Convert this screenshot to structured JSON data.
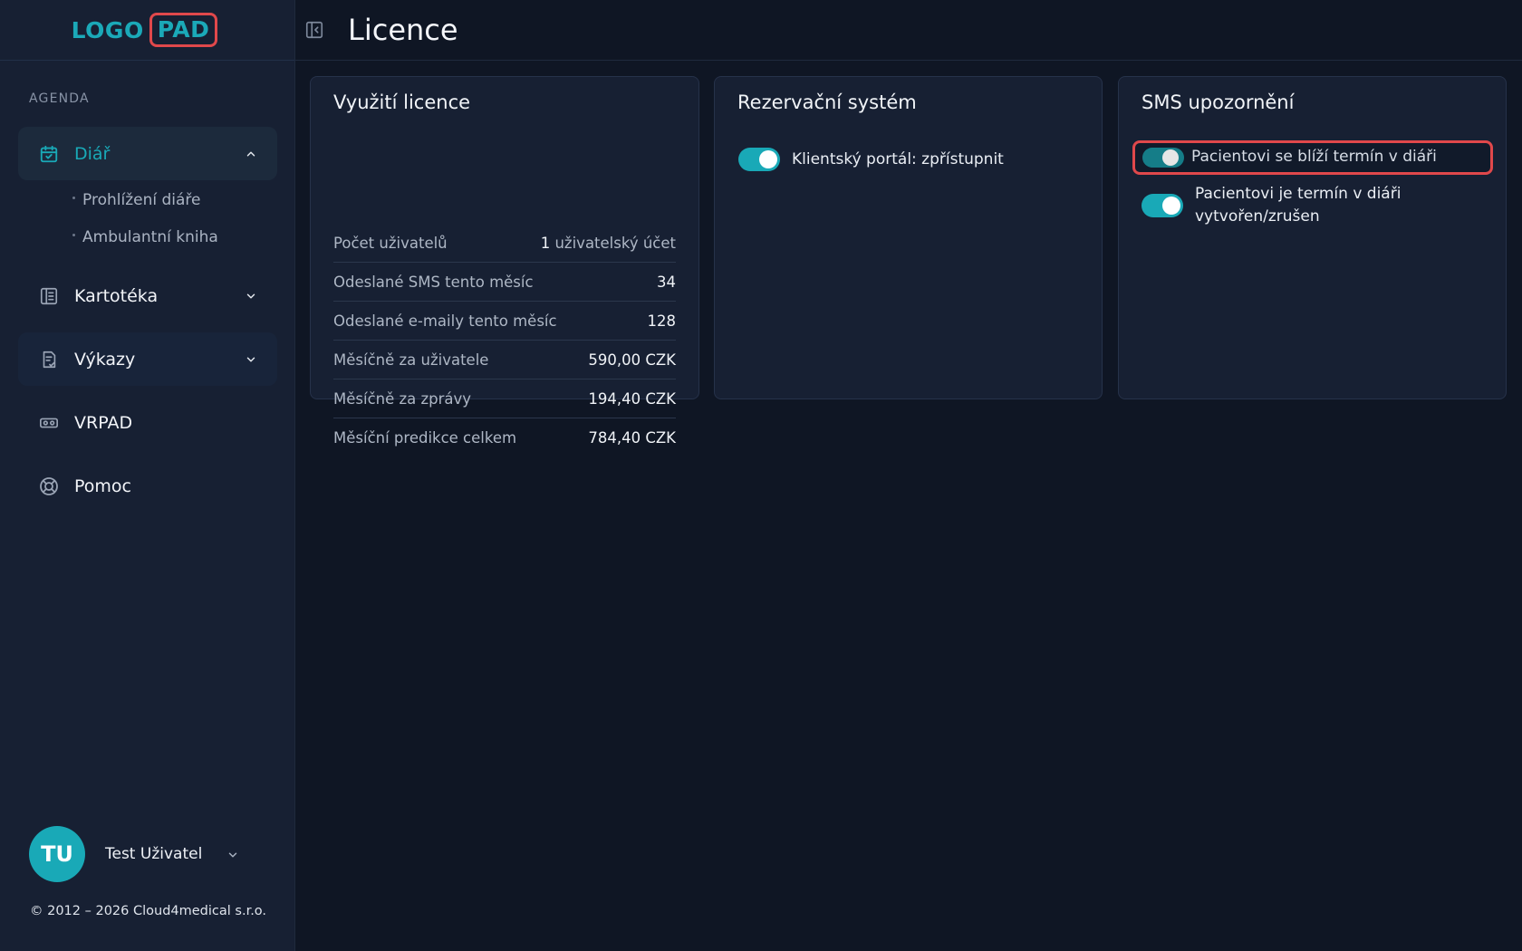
{
  "logo": {
    "part1": "LOGO",
    "part2": "PAD"
  },
  "sidebar": {
    "section_label": "AGENDA",
    "items": [
      {
        "label": "Diář",
        "icon": "calendar-check-icon",
        "expanded": true
      },
      {
        "label": "Kartotéka",
        "icon": "folder-book-icon",
        "expanded": false
      },
      {
        "label": "Výkazy",
        "icon": "report-icon",
        "expanded": false
      },
      {
        "label": "VRPAD",
        "icon": "vr-headset-icon"
      },
      {
        "label": "Pomoc",
        "icon": "lifebuoy-icon"
      }
    ],
    "diar_sub": [
      "Prohlížení diáře",
      "Ambulantní kniha"
    ]
  },
  "user": {
    "initials": "TU",
    "name": "Test Uživatel"
  },
  "copyright": "© 2012 – 2026 Cloud4medical s.r.o.",
  "header": {
    "title": "Licence"
  },
  "license_card": {
    "title": "Využití licence",
    "rows": [
      {
        "label": "Počet uživatelů",
        "value_num": "1",
        "value_text": " uživatelský účet"
      },
      {
        "label": "Odeslané SMS tento měsíc",
        "value": "34"
      },
      {
        "label": "Odeslané e-maily tento měsíc",
        "value": "128"
      },
      {
        "label": "Měsíčně za uživatele",
        "value": "590,00 CZK"
      },
      {
        "label": "Měsíčně za zprávy",
        "value": "194,40 CZK"
      },
      {
        "label": "Měsíční predikce celkem",
        "value": "784,40 CZK"
      }
    ]
  },
  "booking_card": {
    "title": "Rezervační systém",
    "toggle_label": "Klientský portál: zpřístupnit",
    "toggle_on": true
  },
  "sms_card": {
    "title": "SMS upozornění",
    "toggle1_label": "Pacientovi se blíží termín v diáři",
    "toggle1_on": true,
    "toggle2_label_line1": "Pacientovi je termín v diáři",
    "toggle2_label_line2": "vytvořen/zrušen",
    "toggle2_on": true
  },
  "colors": {
    "accent": "#19a9b7",
    "highlight": "#e0484b",
    "background": "#0f1624",
    "panel": "#172033"
  }
}
